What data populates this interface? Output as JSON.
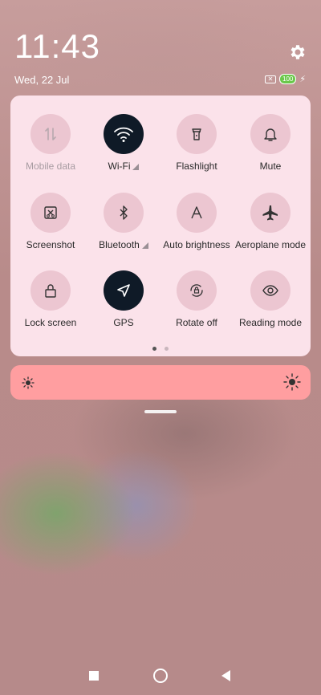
{
  "status": {
    "time": "11:43",
    "date": "Wed, 22 Jul",
    "battery": "100",
    "sim_icon": "sim-off-icon",
    "charging_icon": "bolt-icon"
  },
  "quick_settings": {
    "tiles": [
      {
        "label": "Mobile data",
        "icon": "mobile-data-icon",
        "active": false,
        "disabled": true
      },
      {
        "label": "Wi-Fi",
        "icon": "wifi-icon",
        "active": true
      },
      {
        "label": "Flashlight",
        "icon": "flashlight-icon",
        "active": false
      },
      {
        "label": "Mute",
        "icon": "bell-icon",
        "active": false
      },
      {
        "label": "Screenshot",
        "icon": "screenshot-icon",
        "active": false
      },
      {
        "label": "Bluetooth",
        "icon": "bluetooth-icon",
        "active": false
      },
      {
        "label": "Auto brightness",
        "icon": "auto-brightness-icon",
        "active": false
      },
      {
        "label": "Aeroplane mode",
        "icon": "airplane-icon",
        "active": false
      },
      {
        "label": "Lock screen",
        "icon": "lock-icon",
        "active": false
      },
      {
        "label": "GPS",
        "icon": "location-arrow-icon",
        "active": true
      },
      {
        "label": "Rotate off",
        "icon": "rotate-lock-icon",
        "active": false
      },
      {
        "label": "Reading mode",
        "icon": "eye-icon",
        "active": false
      }
    ],
    "page_count": 2,
    "current_page": 1
  },
  "brightness": {
    "min_icon": "sun-small-icon",
    "max_icon": "sun-large-icon",
    "level": 0.0
  },
  "colors": {
    "active_tile": "#0f1a27",
    "inactive_tile": "#ecc6d1",
    "panel": "#fbe2ea",
    "brightness_bar": "#ff9ea0"
  },
  "nav": {
    "recents": "recents-square-icon",
    "home": "home-circle-icon",
    "back": "back-triangle-icon"
  }
}
